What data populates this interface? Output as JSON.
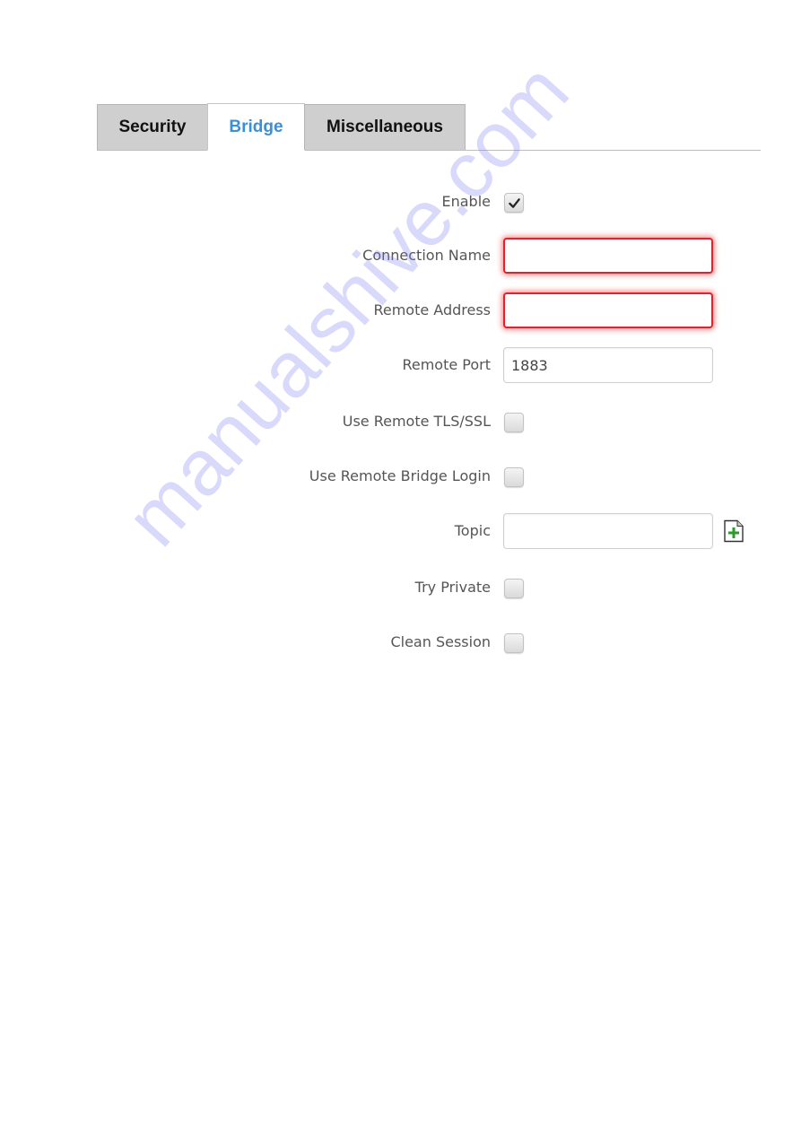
{
  "tabs": [
    {
      "label": "Security",
      "active": false
    },
    {
      "label": "Bridge",
      "active": true
    },
    {
      "label": "Miscellaneous",
      "active": false
    }
  ],
  "form": {
    "enable": {
      "label": "Enable",
      "checked": true
    },
    "connection_name": {
      "label": "Connection Name",
      "value": "",
      "state": "error"
    },
    "remote_address": {
      "label": "Remote Address",
      "value": "",
      "state": "error"
    },
    "remote_port": {
      "label": "Remote Port",
      "value": "1883"
    },
    "use_remote_tls": {
      "label": "Use Remote TLS/SSL",
      "checked": false
    },
    "use_remote_bridge_login": {
      "label": "Use Remote Bridge Login",
      "checked": false
    },
    "topic": {
      "label": "Topic",
      "value": "",
      "add_icon": "add-document-icon"
    },
    "try_private": {
      "label": "Try Private",
      "checked": false
    },
    "clean_session": {
      "label": "Clean Session",
      "checked": false
    }
  },
  "colors": {
    "active_tab": "#3a8fd6",
    "error_border": "#e8202a",
    "add_icon_plus": "#2a9a2a"
  },
  "watermark": "manualshive.com"
}
